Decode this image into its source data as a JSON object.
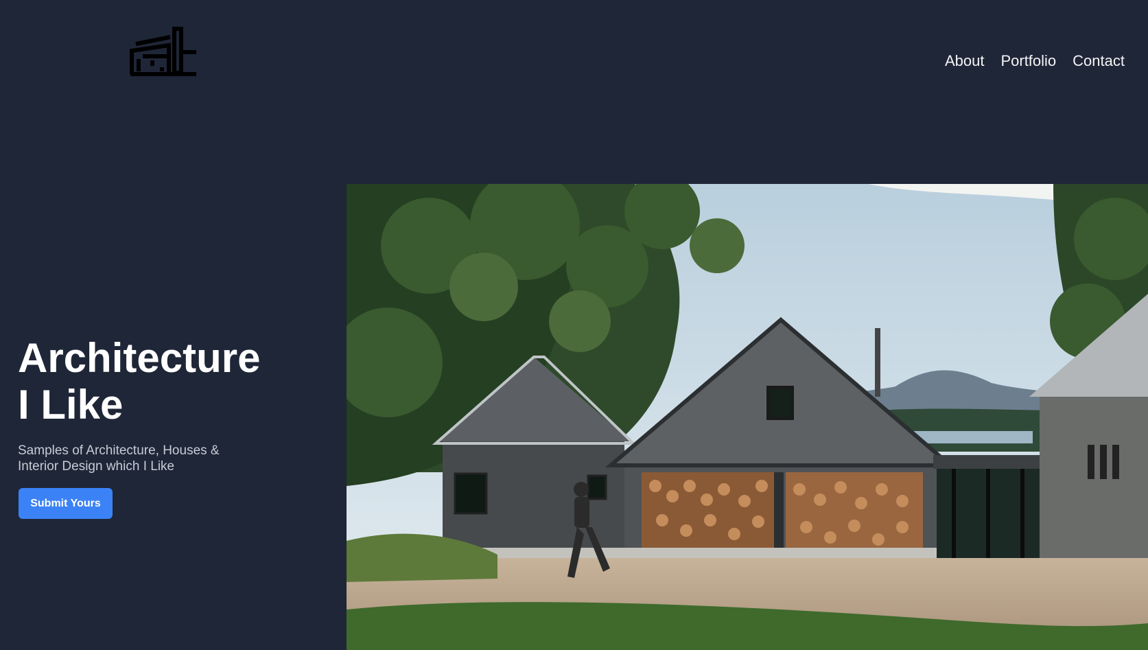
{
  "brand": {
    "logo_icon": "building-logo-icon"
  },
  "nav": {
    "items": [
      {
        "label": "About"
      },
      {
        "label": "Portfolio"
      },
      {
        "label": "Contact"
      }
    ]
  },
  "hero": {
    "title_line1": "Architecture",
    "title_line2": "I Like",
    "subtitle": "Samples of Architecture, Houses & Interior Design which I Like",
    "cta_label": "Submit Yours",
    "image_subject": "cabin-photo"
  },
  "colors": {
    "background": "#1f2637",
    "accent": "#3b82f6",
    "text": "#ffffff",
    "muted_text": "#c7ccd6"
  }
}
